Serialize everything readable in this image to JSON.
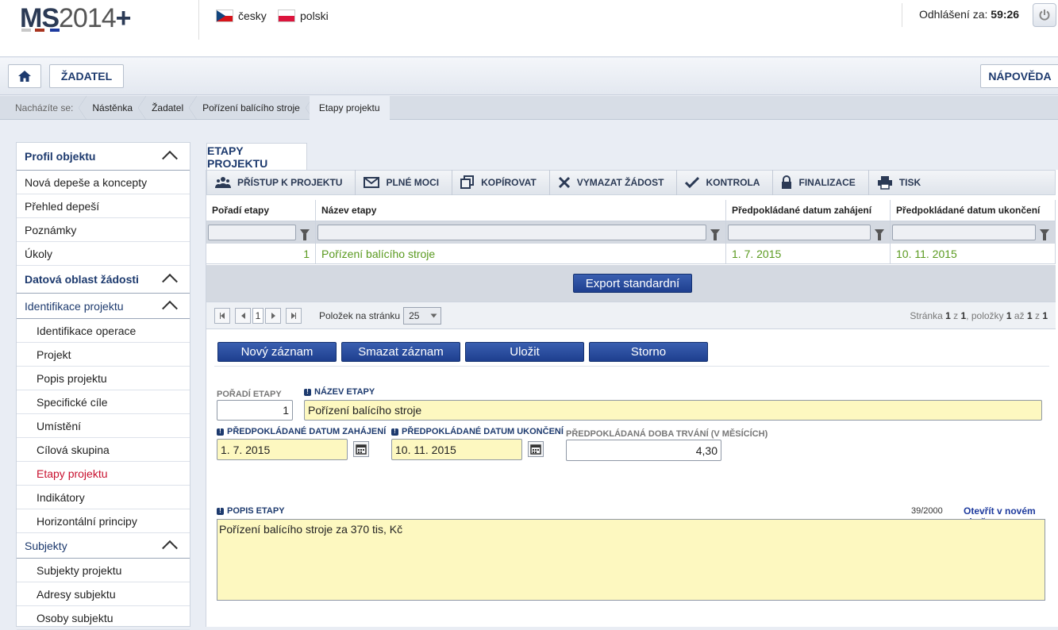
{
  "header": {
    "logo_ms": "MS",
    "logo_year": "2014",
    "logo_plus": "+",
    "languages": [
      {
        "label": "česky",
        "flag": "cz-flag-icon"
      },
      {
        "label": "polski",
        "flag": "pl-flag-icon"
      }
    ],
    "logout_label": "Odhlášení za:",
    "logout_time": "59:26"
  },
  "navbar": {
    "home_icon": "home-icon",
    "zadatel_label": "ŽADATEL",
    "help_label": "NÁPOVĚDA"
  },
  "breadcrumb": {
    "prefix": "Nacházíte se:",
    "items": [
      "Nástěnka",
      "Žadatel",
      "Pořízení balícího stroje",
      "Etapy projektu"
    ]
  },
  "sidebar": {
    "sections": [
      {
        "label": "Profil objektu",
        "items": [
          "Nová depeše a koncepty",
          "Přehled depeší",
          "Poznámky",
          "Úkoly"
        ]
      },
      {
        "label": "Datová oblast žádosti"
      },
      {
        "label": "Identifikace projektu",
        "items": [
          "Identifikace operace",
          "Projekt",
          "Popis projektu",
          "Specifické cíle",
          "Umístění",
          "Cílová skupina",
          "Etapy projektu",
          "Indikátory",
          "Horizontální principy"
        ]
      },
      {
        "label": "Subjekty",
        "items": [
          "Subjekty projektu",
          "Adresy subjektu",
          "Osoby subjektu"
        ]
      }
    ]
  },
  "main": {
    "tab_label": "ETAPY PROJEKTU",
    "toolbar": [
      {
        "label": "PŘÍSTUP K PROJEKTU",
        "icon": "users-icon"
      },
      {
        "label": "PLNÉ MOCI",
        "icon": "envelope-icon"
      },
      {
        "label": "KOPÍROVAT",
        "icon": "copy-icon"
      },
      {
        "label": "VYMAZAT ŽÁDOST",
        "icon": "delete-icon"
      },
      {
        "label": "KONTROLA",
        "icon": "check-icon"
      },
      {
        "label": "FINALIZACE",
        "icon": "lock-icon"
      },
      {
        "label": "TISK",
        "icon": "printer-icon"
      }
    ],
    "grid": {
      "columns": [
        "Pořadí etapy",
        "Název etapy",
        "Předpokládané datum zahájení",
        "Předpokládané datum ukončení"
      ],
      "rows": [
        {
          "poradi": "1",
          "nazev": "Pořízení balícího stroje",
          "zahajeni": "1. 7. 2015",
          "ukonceni": "10. 11. 2015"
        }
      ]
    },
    "export_label": "Export standardní",
    "pager": {
      "current_page": "1",
      "per_page_label": "Položek na stránku",
      "per_page_value": "25",
      "stranka": "Stránka",
      "page": "1",
      "z": "z",
      "pages": "1",
      "polozky": ", položky",
      "from": "1",
      "az": "až",
      "to": "1",
      "z2": "z",
      "total": "1"
    },
    "actions": {
      "new": "Nový záznam",
      "delete": "Smazat záznam",
      "save": "Uložit",
      "cancel": "Storno"
    },
    "form": {
      "poradi_label": "POŘADÍ ETAPY",
      "poradi_value": "1",
      "nazev_label": "NÁZEV ETAPY",
      "nazev_value": "Pořízení balícího stroje",
      "zahajeni_label": "PŘEDPOKLÁDANÉ DATUM ZAHÁJENÍ",
      "zahajeni_value": "1. 7. 2015",
      "ukonceni_label": "PŘEDPOKLÁDANÉ DATUM UKONČENÍ",
      "ukonceni_value": "10. 11. 2015",
      "doba_label": "PŘEDPOKLÁDANÁ DOBA TRVÁNÍ (V MĚSÍCÍCH)",
      "doba_value": "4,30",
      "popis_label": "POPIS ETAPY",
      "popis_counter": "39/2000",
      "popis_open": "Otevřít v novém okně",
      "popis_value": "Pořízení balícího stroje za 370 tis, Kč"
    }
  },
  "colors": {
    "brand_blue": "#1d3a6e",
    "button_blue": "#2a4ea0",
    "active_red": "#c8102e",
    "value_green": "#5a9a1f",
    "required_yellow": "#fdf8c0"
  }
}
